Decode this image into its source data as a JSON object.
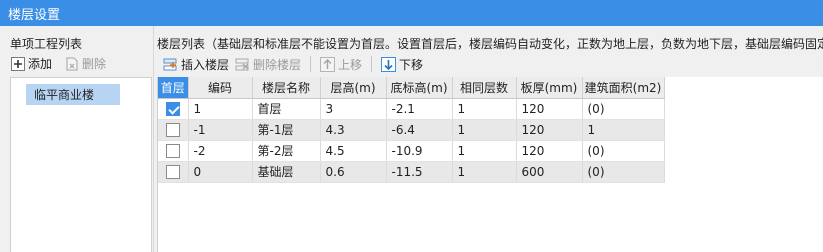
{
  "window": {
    "title": "楼层设置"
  },
  "left_panel": {
    "title": "单项工程列表",
    "add_label": "添加",
    "delete_label": "删除",
    "items": [
      {
        "label": "临平商业楼",
        "selected": true
      }
    ]
  },
  "right_panel": {
    "title": "楼层列表（基础层和标准层不能设置为首层。设置首层后，楼层编码自动变化，正数为地上层，负数为地下层，基础层编码固定",
    "toolbar": {
      "insert_label": "插入楼层",
      "delete_label": "删除楼层",
      "up_label": "上移",
      "down_label": "下移"
    },
    "columns": [
      "首层",
      "编码",
      "楼层名称",
      "层高(m)",
      "底标高(m)",
      "相同层数",
      "板厚(mm)",
      "建筑面积(m2)"
    ],
    "rows": [
      {
        "first": true,
        "code": "1",
        "name": "首层",
        "height": "3",
        "bottom": "-2.1",
        "same": "1",
        "thick": "120",
        "area": "(0)"
      },
      {
        "first": false,
        "code": "-1",
        "name": "第-1层",
        "height": "4.3",
        "bottom": "-6.4",
        "same": "1",
        "thick": "120",
        "area": "1"
      },
      {
        "first": false,
        "code": "-2",
        "name": "第-2层",
        "height": "4.5",
        "bottom": "-10.9",
        "same": "1",
        "thick": "120",
        "area": "(0)"
      },
      {
        "first": false,
        "code": "0",
        "name": "基础层",
        "height": "0.6",
        "bottom": "-11.5",
        "same": "1",
        "thick": "600",
        "area": "(0)"
      }
    ]
  },
  "colors": {
    "accent": "#3a8ee6",
    "selection": "#b7d4f3"
  }
}
